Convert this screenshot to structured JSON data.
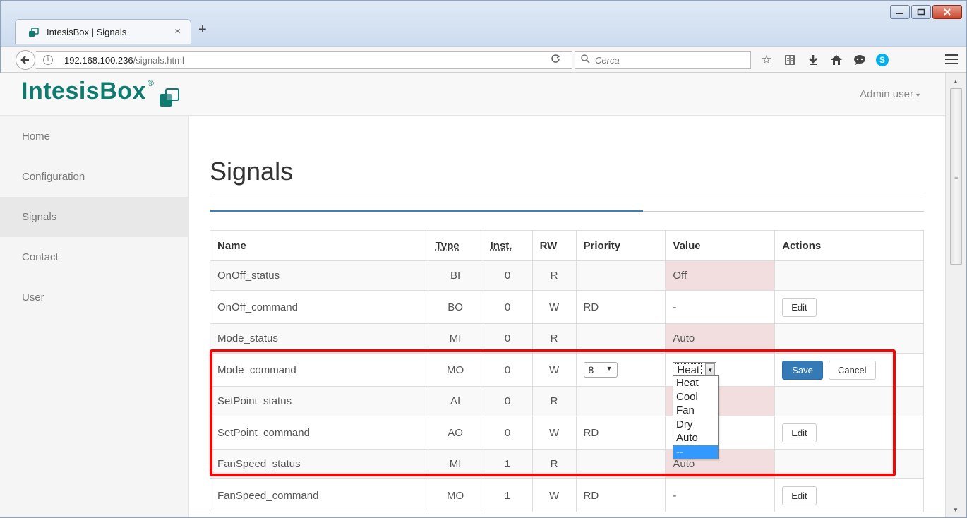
{
  "browser": {
    "tab_title": "IntesisBox | Signals",
    "tab_close": "×",
    "new_tab": "+",
    "url_host": "192.168.100.236",
    "url_path": "/signals.html",
    "search_placeholder": "Cerca",
    "window_buttons": {
      "minimize": "▭",
      "maximize": "□",
      "close": "✕"
    }
  },
  "header": {
    "brand_name": "IntesisBox",
    "brand_reg": "®",
    "user_menu": "Admin user"
  },
  "sidebar": {
    "items": [
      {
        "label": "Home",
        "active": false
      },
      {
        "label": "Configuration",
        "active": false
      },
      {
        "label": "Signals",
        "active": true
      },
      {
        "label": "Contact",
        "active": false
      },
      {
        "label": "User",
        "active": false
      }
    ]
  },
  "main": {
    "title": "Signals",
    "table": {
      "headers": {
        "name": "Name",
        "type": "Type",
        "inst": "Inst.",
        "rw": "RW",
        "priority": "Priority",
        "value": "Value",
        "actions": "Actions"
      },
      "rows": [
        {
          "name": "OnOff_status",
          "type": "BI",
          "inst": "0",
          "rw": "R",
          "priority": "",
          "value": "Off",
          "action": ""
        },
        {
          "name": "OnOff_command",
          "type": "BO",
          "inst": "0",
          "rw": "W",
          "priority": "RD",
          "value": "-",
          "action": "Edit"
        },
        {
          "name": "Mode_status",
          "type": "MI",
          "inst": "0",
          "rw": "R",
          "priority": "",
          "value": "Auto",
          "action": ""
        },
        {
          "name": "Mode_command",
          "type": "MO",
          "inst": "0",
          "rw": "W",
          "priority": "8",
          "value": "Heat",
          "save": "Save",
          "cancel": "Cancel"
        },
        {
          "name": "SetPoint_status",
          "type": "AI",
          "inst": "0",
          "rw": "R",
          "priority": "",
          "value": "",
          "action": ""
        },
        {
          "name": "SetPoint_command",
          "type": "AO",
          "inst": "0",
          "rw": "W",
          "priority": "RD",
          "value": "",
          "action": "Edit"
        },
        {
          "name": "FanSpeed_status",
          "type": "MI",
          "inst": "1",
          "rw": "R",
          "priority": "",
          "value": "Auto",
          "action": ""
        },
        {
          "name": "FanSpeed_command",
          "type": "MO",
          "inst": "1",
          "rw": "W",
          "priority": "RD",
          "value": "-",
          "action": "Edit"
        }
      ]
    },
    "value_dropdown": {
      "options": [
        "Heat",
        "Cool",
        "Fan",
        "Dry",
        "Auto",
        "--"
      ],
      "highlighted_index": 5
    }
  },
  "colors": {
    "brand": "#0f7a6e",
    "accent_blue": "#3f7fb9",
    "status_red_bg": "#f2dede",
    "annotation_box": "#ff0000"
  }
}
